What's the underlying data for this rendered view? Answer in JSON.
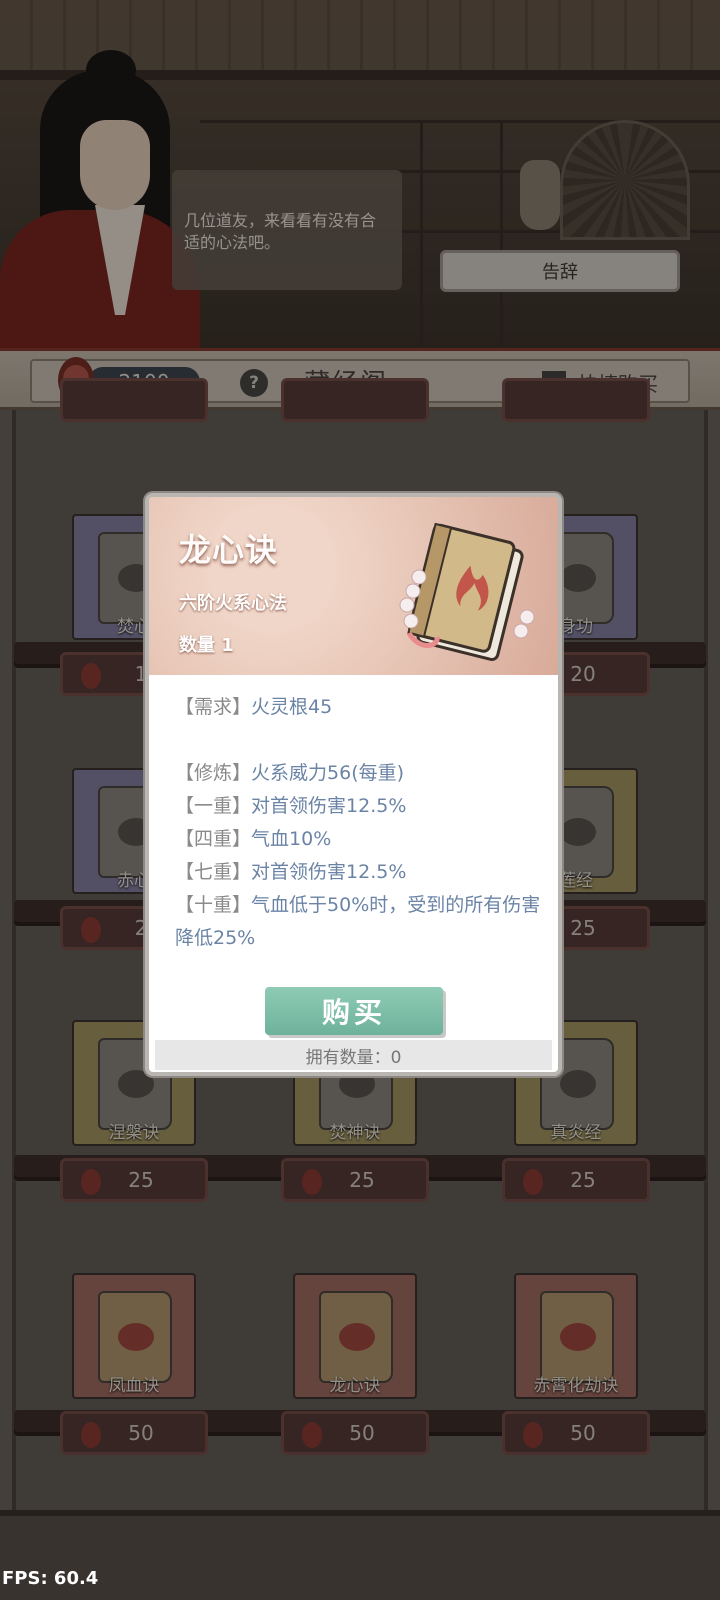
{
  "npc": {
    "speech": "几位道友，来看看有没有合适的心法吧。",
    "leave_label": "告辞"
  },
  "header": {
    "currency": "2100",
    "help_label": "?",
    "title": "藏经阁",
    "quick_buy_label": "快捷购买"
  },
  "items": [
    {
      "name": "焚心",
      "price": "1",
      "tint": "#8782a3"
    },
    {
      "name": "身功",
      "price": "20",
      "tint": "#8782a3"
    },
    {
      "name": "赤心",
      "price": "2",
      "tint": "#8782a3"
    },
    {
      "name": "莲经",
      "price": "25",
      "tint": "#a79863"
    },
    {
      "name": "涅槃诀",
      "price": "25",
      "tint": "#a79863"
    },
    {
      "name": "焚神诀",
      "price": "25",
      "tint": "#a79863"
    },
    {
      "name": "真炎经",
      "price": "25",
      "tint": "#a79863"
    },
    {
      "name": "凤血诀",
      "price": "50",
      "tint": "#a46e63"
    },
    {
      "name": "龙心诀",
      "price": "50",
      "tint": "#a46e63"
    },
    {
      "name": "赤霄化劫诀",
      "price": "50",
      "tint": "#a46e63"
    }
  ],
  "popup": {
    "title": "龙心诀",
    "type": "六阶火系心法",
    "quantity": "数量 1",
    "requirement_tag": "【需求】",
    "requirement": "火灵根45",
    "lines": [
      {
        "tag": "【修炼】",
        "text": "火系威力56(每重)"
      },
      {
        "tag": "【一重】",
        "text": "对首领伤害12.5%"
      },
      {
        "tag": "【四重】",
        "text": "气血10%"
      },
      {
        "tag": "【七重】",
        "text": "对首领伤害12.5%"
      },
      {
        "tag": "【十重】",
        "text": "气血低于50%时，受到的所有伤害降低25%"
      }
    ],
    "buy_label": "购买",
    "owned": "拥有数量：0"
  },
  "fps": "FPS: 60.4",
  "colors": {
    "accent_green": "#7fbfa8",
    "text_blue": "#6b84a6",
    "header_red": "#8a3b33"
  }
}
